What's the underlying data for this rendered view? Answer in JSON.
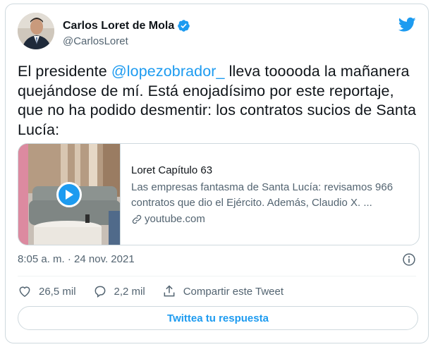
{
  "author": {
    "name": "Carlos Loret de Mola",
    "handle": "@CarlosLoret",
    "verified": true
  },
  "tweet": {
    "text_before": "El presidente ",
    "mention": "@lopezobrador_",
    "text_after": " lleva tooooda la mañanera quejándose de mí. Está enojadísimo por este reportaje, que no ha podido desmentir: los contratos sucios de Santa Lucía:"
  },
  "link_card": {
    "title": "Loret Capítulo 63",
    "description": "Las empresas fantasma de Santa Lucía: revisamos 966 contratos que dio el Ejército. Además, Claudio X. ...",
    "domain": "youtube.com"
  },
  "meta": {
    "timestamp": "8:05 a. m. · 24 nov. 2021"
  },
  "actions": {
    "likes": "26,5 mil",
    "replies": "2,2 mil",
    "share_label": "Compartir este Tweet"
  },
  "reply_button": "Twittea tu respuesta",
  "colors": {
    "accent": "#1d9bf0",
    "text": "#0f1419",
    "secondary": "#536471",
    "border": "#cfd9de"
  },
  "icons": [
    "verified-badge-icon",
    "twitter-bird-icon",
    "play-icon",
    "link-icon",
    "info-icon",
    "heart-icon",
    "reply-icon",
    "share-icon"
  ]
}
